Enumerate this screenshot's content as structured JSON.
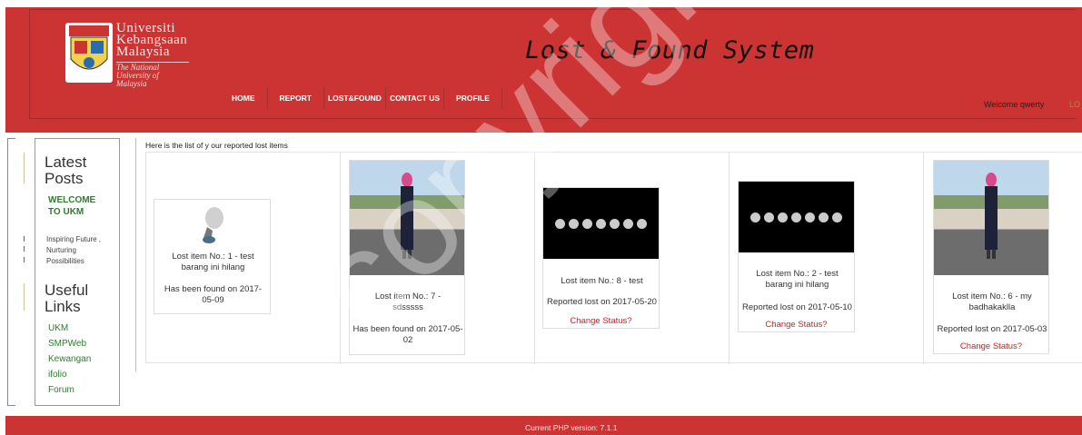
{
  "header": {
    "uni_name": [
      "Universiti",
      "Kebangsaan",
      "Malaysia"
    ],
    "uni_tag": "The National University of Malaysia",
    "site_title": "Lost & Found System",
    "welcome": "Welcome qwerty",
    "logout": "LO"
  },
  "nav": [
    "HOME",
    "REPORT",
    "LOST&FOUND",
    "CONTACT US",
    "PROFILE"
  ],
  "sidebar": {
    "latest_posts": "Latest Posts",
    "welcome": "WELCOME TO UKM",
    "tagline": "Inspiring Future , Nurturing Possibilities",
    "useful_links": "Useful Links",
    "links": [
      "UKM",
      "SMPWeb",
      "Kewangan",
      "ifolio",
      "Forum"
    ]
  },
  "main": {
    "list_title": "Here is the list of y our reported lost items",
    "items": [
      {
        "title": "Lost item No.: 1 - test barang ini hilang",
        "status": "Has been found on 2017-05-09",
        "image": "pointer-icon"
      },
      {
        "title": "Lost item No.: 7 - sdsssss",
        "status": "Has been found on 2017-05-02",
        "image": "photo"
      },
      {
        "title": "Lost item No.: 8 - test",
        "status": "Reported lost on 2017-05-20",
        "action": "Change Status?",
        "image": "moon-phases"
      },
      {
        "title": "Lost item No.: 2 - test barang ini hilang",
        "status": "Reported lost on 2017-05-10",
        "action": "Change Status?",
        "image": "moon-phases"
      },
      {
        "title": "Lost item No.: 6 - my badhakaklla",
        "status": "Reported lost on 2017-05-03",
        "action": "Change Status?",
        "image": "photo"
      }
    ]
  },
  "footer": {
    "text": "Current PHP version: 7.1.1"
  },
  "watermark": "copyright@"
}
